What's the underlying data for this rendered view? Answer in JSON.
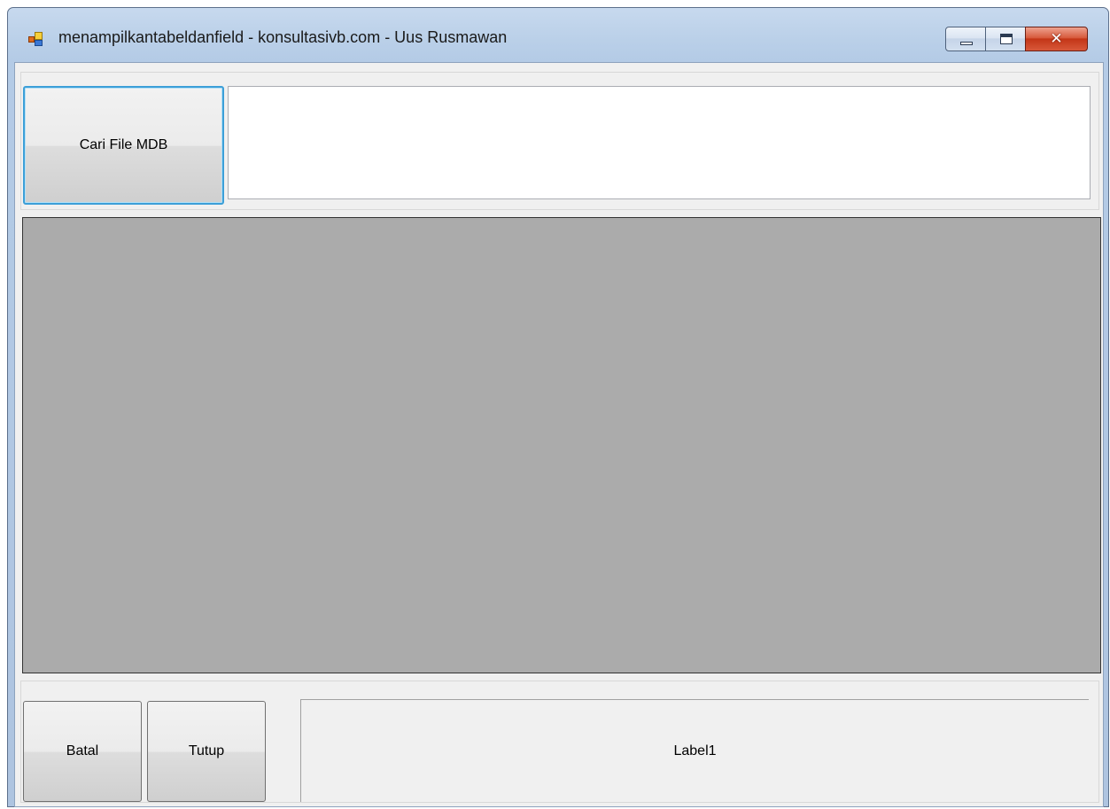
{
  "window": {
    "title": "menampilkantabeldanfield - konsultasivb.com - Uus Rusmawan",
    "icon": "app-form-icon",
    "controls": {
      "minimize_icon": "minimize-icon",
      "maximize_icon": "maximize-icon",
      "close_icon": "close-icon",
      "close_glyph": "✕"
    }
  },
  "top": {
    "browse_button_label": "Cari File MDB",
    "path_value": ""
  },
  "grid": {
    "rows": []
  },
  "bottom": {
    "cancel_label": "Batal",
    "close_label": "Tutup",
    "status_label": "Label1"
  },
  "colors": {
    "grid_background": "#ababab",
    "form_background": "#f0f0f0",
    "focus_border": "#3c9fd8"
  }
}
